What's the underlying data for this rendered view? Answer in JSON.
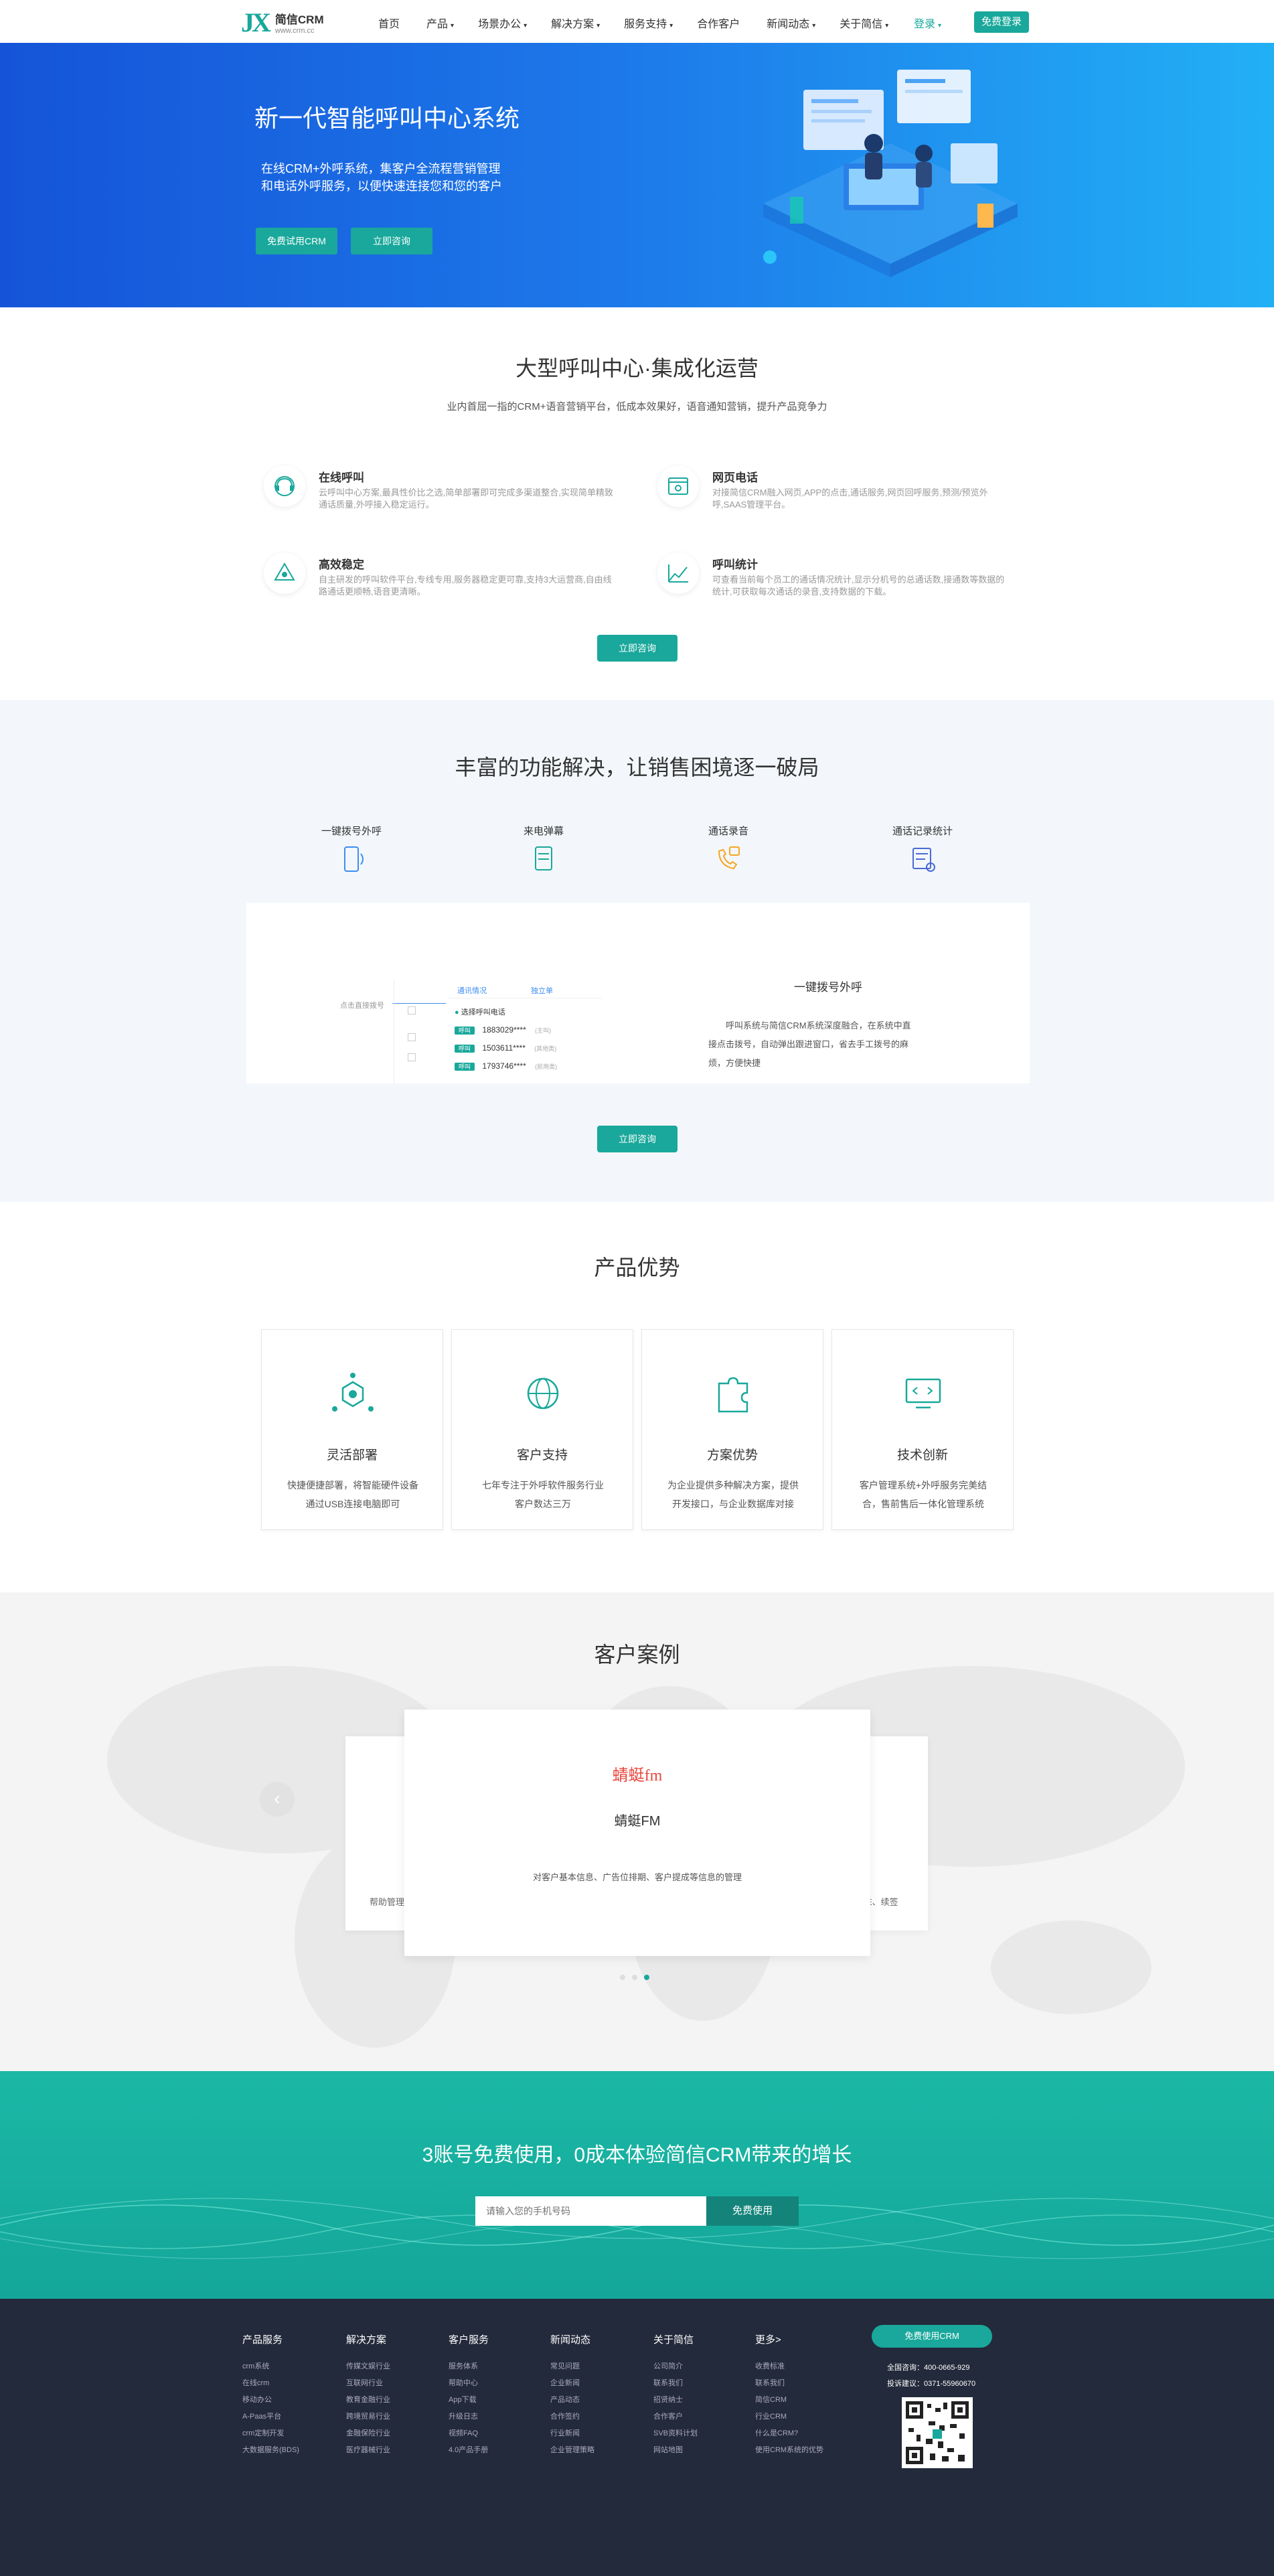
{
  "nav": {
    "logo_mark": "JX",
    "logo_name": "简信CRM",
    "logo_url": "www.crm.cc",
    "items": [
      {
        "label": "首页",
        "caret": ""
      },
      {
        "label": "产品",
        "caret": "▾"
      },
      {
        "label": "场景办公",
        "caret": "▾"
      },
      {
        "label": "解决方案",
        "caret": "▾"
      },
      {
        "label": "服务支持",
        "caret": "▾"
      },
      {
        "label": "合作客户",
        "caret": ""
      },
      {
        "label": "新闻动态",
        "caret": "▾"
      },
      {
        "label": "关于简信",
        "caret": "▾"
      }
    ],
    "login": "登录",
    "login_caret": "▾",
    "free_login": "免费登录"
  },
  "hero": {
    "title": "新一代智能呼叫中心系统",
    "desc_line1": "在线CRM+外呼系统，集客户全流程营销管理",
    "desc_line2": "和电话外呼服务，以便快速连接您和您的客户",
    "btn_trial": "免费试用CRM",
    "btn_consult": "立即咨询"
  },
  "section2": {
    "title": "大型呼叫中心·集成化运营",
    "subtitle": "业内首屈一指的CRM+语音营销平台，低成本效果好，语音通知营销，提升产品竞争力",
    "features": [
      {
        "title": "在线呼叫",
        "desc": "云呼叫中心方案,最具性价比之选,简单部署即可完成多渠道整合,实现简单精致通话质量,外呼接入稳定运行。"
      },
      {
        "title": "网页电话",
        "desc": "对接简信CRM融入网页,APP的点击,通话服务,网页回呼服务,预测/预览外呼,SAAS管理平台。"
      },
      {
        "title": "高效稳定",
        "desc": "自主研发的呼叫软件平台,专线专用,服务器稳定更可靠,支持3大运营商,自由线路通话更顺畅,语音更清晰。"
      },
      {
        "title": "呼叫统计",
        "desc": "可查看当前每个员工的通话情况统计,显示分机号的总通话数,接通数等数据的统计,可获取每次通话的录音,支持数据的下载。"
      }
    ],
    "btn": "立即咨询"
  },
  "section3": {
    "title": "丰富的功能解决，让销售困境逐一破局",
    "tabs": [
      "一键拨号外呼",
      "来电弹幕",
      "通话录音",
      "通话记录统计"
    ],
    "demo_title": "一键拨号外呼",
    "demo_desc_l1": "呼叫系统与简信CRM系统深度融合，在系统中直",
    "demo_desc_l2": "接点击拨号，自动弹出跟进窗口，省去手工拨号的麻",
    "demo_desc_l3": "烦，方便快捷",
    "mock_hint": "点击直接拨号",
    "mock_tab1": "通讯情况",
    "mock_tab2": "独立单",
    "mock_call": "选择呼叫电话",
    "mock_rows": [
      {
        "tag": "呼叫",
        "num": "1883029****",
        "note": "(主叫)"
      },
      {
        "tag": "呼叫",
        "num": "1503611****",
        "note": "(其他类)"
      },
      {
        "tag": "呼叫",
        "num": "1793746****",
        "note": "(前用类)"
      }
    ],
    "btn": "立即咨询"
  },
  "section4": {
    "title": "产品优势",
    "cards": [
      {
        "title": "灵活部署",
        "desc_l1": "快捷便捷部署，将智能硬件设备",
        "desc_l2": "通过USB连接电脑即可"
      },
      {
        "title": "客户支持",
        "desc_l1": "七年专注于外呼软件服务行业",
        "desc_l2": "客户数达三万"
      },
      {
        "title": "方案优势",
        "desc_l1": "为企业提供多种解决方案，提供",
        "desc_l2": "开发接口，与企业数据库对接"
      },
      {
        "title": "技术创新",
        "desc_l1": "客户管理系统+外呼服务完美结",
        "desc_l2": "合，售前售后一体化管理系统"
      }
    ]
  },
  "section5": {
    "title": "客户案例",
    "client_logo": "蜻蜓fm",
    "client_name": "蜻蜓FM",
    "client_desc": "对客户基本信息、广告位排期、客户提成等信息的管理",
    "side_left_text": "帮助管理",
    "side_right_text": "E、续签"
  },
  "section6": {
    "title": "3账号免费使用，0成本体验简信CRM带来的增长",
    "placeholder": "请输入您的手机号码",
    "btn": "免费使用"
  },
  "footer": {
    "cols": [
      {
        "head": "产品服务",
        "items": [
          "crm系统",
          "在线crm",
          "移动办公",
          "A-Paas平台",
          "crm定制开发",
          "大数据服务(BDS)"
        ]
      },
      {
        "head": "解决方案",
        "items": [
          "传媒文娱行业",
          "互联网行业",
          "教育金融行业",
          "跨境贸易行业",
          "金融保险行业",
          "医疗器械行业"
        ]
      },
      {
        "head": "客户服务",
        "items": [
          "服务体系",
          "帮助中心",
          "App下载",
          "升级日志",
          "视频FAQ",
          "4.0产品手册"
        ]
      },
      {
        "head": "新闻动态",
        "items": [
          "常见问题",
          "企业新闻",
          "产品动态",
          "合作签约",
          "行业新闻",
          "企业管理策略"
        ]
      },
      {
        "head": "关于简信",
        "items": [
          "公司简介",
          "联系我们",
          "招贤纳士",
          "合作客户",
          "SVB资料计划",
          "网站地图"
        ]
      },
      {
        "head": "更多>",
        "items": [
          "收费标准",
          "联系我们",
          "简信CRM",
          "行业CRM",
          "什么是CRM?",
          "使用CRM系统的优势"
        ]
      }
    ],
    "btn": "免费使用CRM",
    "phone_label": "全国咨询：",
    "phone": "400-0665-929",
    "complaint_label": "投诉建议：",
    "complaint": "0371-55960670"
  },
  "colors": {
    "brand": "#19a89b",
    "hero_start": "#1554d8",
    "hero_end": "#22b0f5",
    "footer": "#232a3b"
  }
}
